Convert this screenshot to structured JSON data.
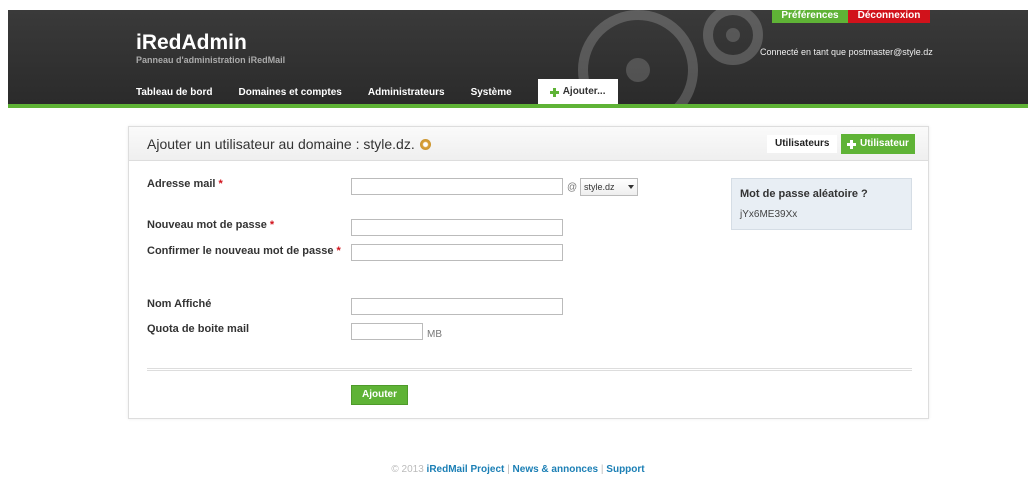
{
  "header": {
    "title": "iRedAdmin",
    "subtitle": "Panneau d'administration iRedMail",
    "preferences_label": "Préférences",
    "logout_label": "Déconnexion",
    "logged_in_text": "Connecté en tant que postmaster@style.dz",
    "nav": [
      {
        "label": "Tableau de bord"
      },
      {
        "label": "Domaines et comptes"
      },
      {
        "label": "Administrateurs"
      },
      {
        "label": "Système"
      }
    ],
    "add_label": "Ajouter..."
  },
  "panel": {
    "title": "Ajouter un utilisateur au domaine : style.dz.",
    "tab_users": "Utilisateurs",
    "tab_add_user": "Utilisateur"
  },
  "form": {
    "email_label": "Adresse mail",
    "email_value": "",
    "at_sign": "@",
    "domain_selected": "style.dz",
    "password_label": "Nouveau mot de passe",
    "confirm_label": "Confirmer le nouveau mot de passe",
    "required_mark": "*",
    "display_name_label": "Nom Affiché",
    "quota_label": "Quota de boite mail",
    "quota_unit": "MB",
    "submit_label": "Ajouter"
  },
  "random_password": {
    "title": "Mot de passe aléatoire ?",
    "value": "jYx6ME39Xx"
  },
  "footer": {
    "copyright": "© 2013",
    "project_link": "iRedMail Project",
    "news_link": "News & annonces",
    "support_link": "Support",
    "separator": "|"
  },
  "colors": {
    "accent_green": "#5fb336",
    "logout_red": "#d1121b",
    "header_dark": "#2f2f2f",
    "link_blue": "#1b7fb5"
  }
}
